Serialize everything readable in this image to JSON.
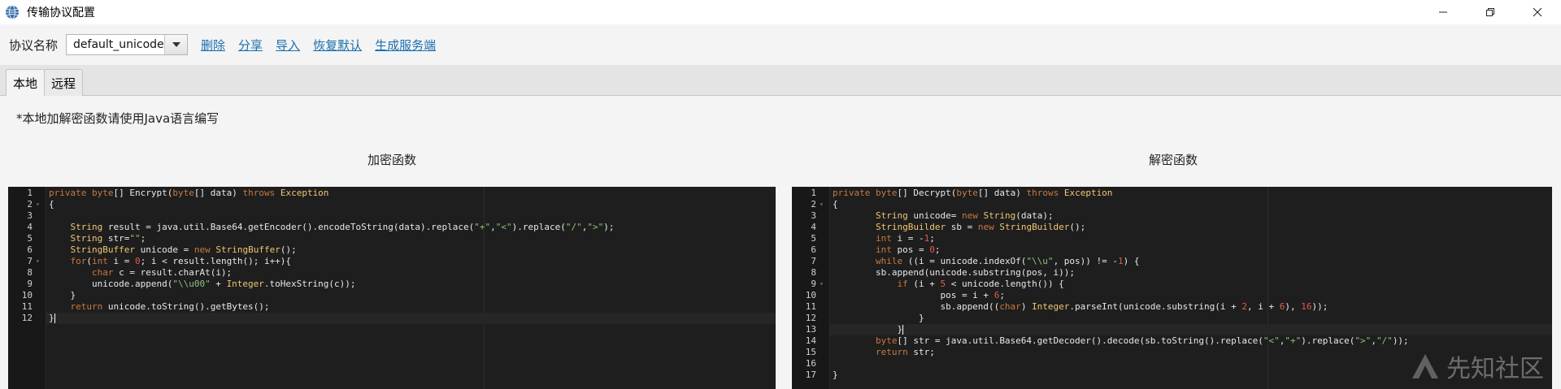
{
  "window": {
    "title": "传输协议配置"
  },
  "toolbar": {
    "protocol_label": "协议名称",
    "protocol_value": "default_unicode",
    "links": [
      "删除",
      "分享",
      "导入",
      "恢复默认",
      "生成服务端"
    ]
  },
  "tabs": [
    "本地",
    "远程"
  ],
  "note": "*本地加解密函数请使用Java语言编写",
  "encrypt": {
    "title": "加密函数",
    "line_numbers": [
      "1",
      "2",
      "3",
      "4",
      "5",
      "6",
      "7",
      "8",
      "9",
      "10",
      "11",
      "12"
    ],
    "code": [
      "private byte[] Encrypt(byte[] data) throws Exception",
      "{",
      "",
      "    String result = java.util.Base64.getEncoder().encodeToString(data).replace(\"+\",\"<\").replace(\"/\",\">\");",
      "    String str=\"\";",
      "    StringBuffer unicode = new StringBuffer();",
      "    for(int i = 0; i < result.length(); i++){",
      "        char c = result.charAt(i);",
      "        unicode.append(\"\\\\u00\" + Integer.toHexString(c));",
      "    }",
      "    return unicode.toString().getBytes();",
      "}"
    ]
  },
  "decrypt": {
    "title": "解密函数",
    "line_numbers": [
      "1",
      "2",
      "3",
      "4",
      "5",
      "6",
      "7",
      "8",
      "9",
      "10",
      "11",
      "12",
      "13",
      "14",
      "15",
      "16",
      "17"
    ],
    "code": [
      "private byte[] Decrypt(byte[] data) throws Exception",
      "{",
      "        String unicode= new String(data);",
      "        StringBuilder sb = new StringBuilder();",
      "        int i = -1;",
      "        int pos = 0;",
      "        while ((i = unicode.indexOf(\"\\\\u\", pos)) != -1) {",
      "        sb.append(unicode.substring(pos, i));",
      "            if (i + 5 < unicode.length()) {",
      "                    pos = i + 6;",
      "                    sb.append((char) Integer.parseInt(unicode.substring(i + 2, i + 6), 16));",
      "                }",
      "            }",
      "        byte[] str = java.util.Base64.getDecoder().decode(sb.toString().replace(\"<\",\"+\").replace(\">\",\"/\"));",
      "        return str;",
      "",
      "}"
    ]
  },
  "watermark": "先知社区",
  "colors": {
    "link": "#1b6fae",
    "editor_bg": "#1e1e1e",
    "keyword": "#c9783f",
    "type": "#f0c674",
    "number": "#e05a4f",
    "string": "#8ec07c"
  }
}
